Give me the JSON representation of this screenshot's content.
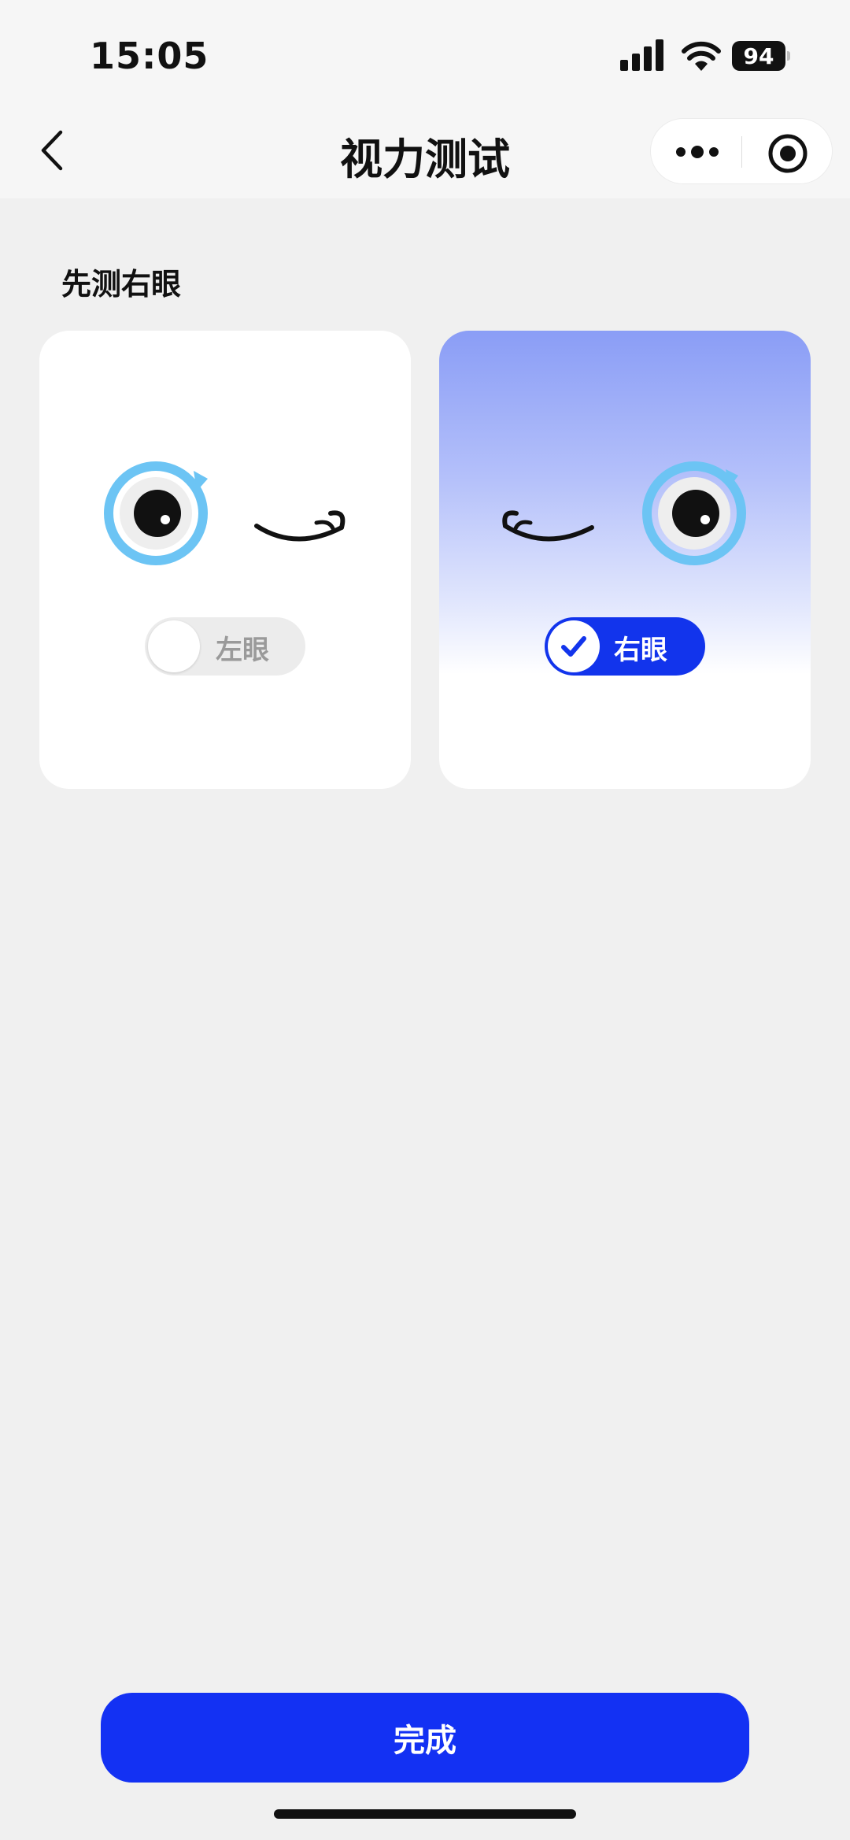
{
  "status_bar": {
    "time": "15:05",
    "battery_level": "94",
    "icons": [
      "signal-icon",
      "wifi-icon",
      "battery-icon"
    ]
  },
  "nav": {
    "title": "视力测试",
    "icons": [
      "back-icon",
      "more-icon",
      "target-icon"
    ]
  },
  "main": {
    "section_label": "先测右眼",
    "options": [
      {
        "label": "左眼",
        "selected": false
      },
      {
        "label": "右眼",
        "selected": true
      }
    ]
  },
  "footer": {
    "done_label": "完成"
  },
  "colors": {
    "accent": "#1331f3",
    "eye_ring": "#6cc4f4",
    "card_gradient_top": "#8a9df6",
    "page_background": "#f0f0f0"
  }
}
